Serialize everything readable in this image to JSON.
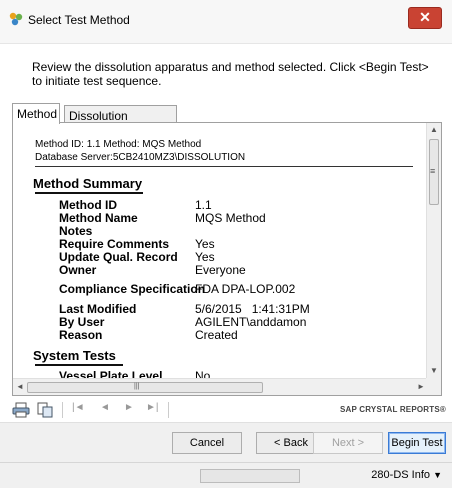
{
  "window": {
    "title": "Select Test Method",
    "close_glyph": "✕",
    "icon": "app-molecule-icon"
  },
  "instructions": "Review the dissolution apparatus and method selected. Click <Begin Test> to initiate test sequence.",
  "tabs": [
    {
      "label": "Method",
      "active": true
    },
    {
      "label": "Dissolution Apparatus",
      "active": false
    }
  ],
  "report": {
    "meta_line1": "Method ID: 1.1  Method: MQS Method",
    "meta_line2": "Database Server:5CB2410MZ3\\DISSOLUTION",
    "method_summary_title": "Method Summary",
    "rows": [
      {
        "label": "Method ID",
        "value": "1.1"
      },
      {
        "label": "Method Name",
        "value": "MQS Method"
      },
      {
        "label": "Notes",
        "value": ""
      },
      {
        "label": "Require Comments",
        "value": "Yes"
      },
      {
        "label": "Update Qual. Record",
        "value": "Yes"
      },
      {
        "label": "Owner",
        "value": "Everyone"
      },
      {
        "label": "Compliance Specification",
        "value": "FDA DPA-LOP.002"
      },
      {
        "label": "Last Modified",
        "value": "5/6/2015   1:41:31PM"
      },
      {
        "label": "By User",
        "value": "AGILENT\\anddamon"
      },
      {
        "label": "Reason",
        "value": "Created"
      }
    ],
    "system_tests_title": "System Tests",
    "system_rows": [
      {
        "label": "Vessel Plate Level",
        "value": "No"
      }
    ]
  },
  "scroll": {
    "up": "▲",
    "down": "▼",
    "left": "◄",
    "right": "►",
    "grip": "≡",
    "hgrip": "|||"
  },
  "toolbar": {
    "nav_first": "|◄",
    "nav_prev": "◄",
    "nav_next": "►",
    "nav_last": "►|",
    "brand": "SAP CRYSTAL REPORTS®"
  },
  "buttons": {
    "cancel": "Cancel",
    "back": "< Back",
    "next": "Next >",
    "begin": "Begin Test"
  },
  "status": {
    "info": "280-DS Info",
    "dropdown": "▼"
  },
  "colors": {
    "close": "#c94333",
    "primary_border": "#3a7bd5"
  }
}
